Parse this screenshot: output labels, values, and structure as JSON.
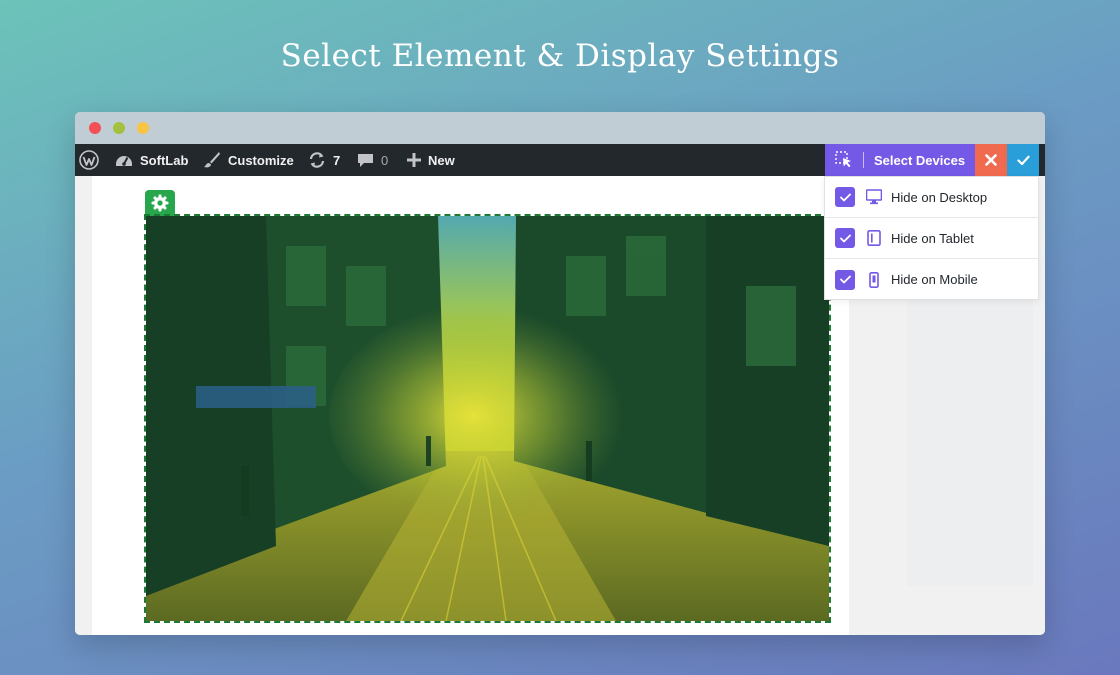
{
  "headline": "Select Element & Display Settings",
  "admin_bar": {
    "wp_logo_icon": "wordpress-icon",
    "site_name": "SoftLab",
    "customize": "Customize",
    "updates_count": "7",
    "comments_count": "0",
    "new_label": "New",
    "select_devices_label": "Select Devices"
  },
  "device_menu": {
    "items": [
      {
        "label": "Hide on Desktop",
        "icon": "desktop-icon",
        "checked": true
      },
      {
        "label": "Hide on Tablet",
        "icon": "tablet-icon",
        "checked": true
      },
      {
        "label": "Hide on Mobile",
        "icon": "mobile-icon",
        "checked": true
      }
    ]
  },
  "colors": {
    "accent": "#7458e6",
    "close": "#ef6a4f",
    "confirm": "#2a9ed8",
    "selection": "#27a64b",
    "admin_bar": "#23282d"
  }
}
